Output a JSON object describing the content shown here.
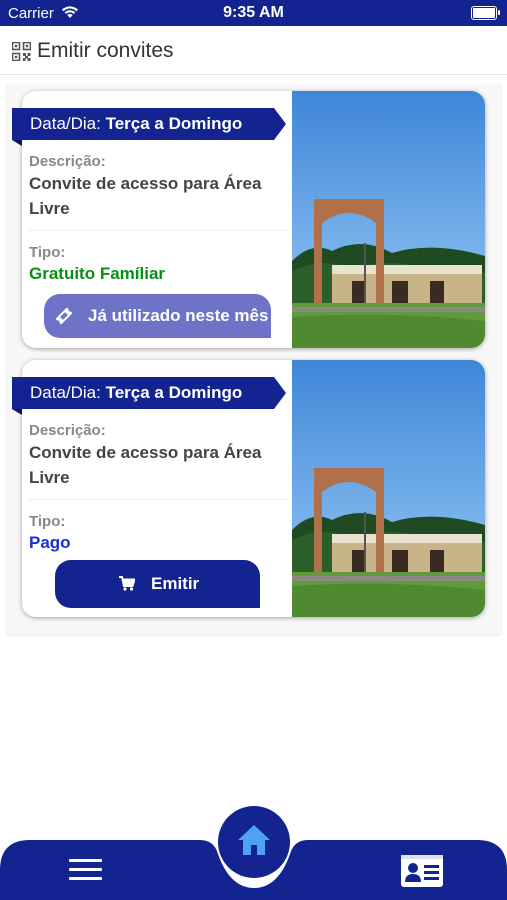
{
  "status_bar": {
    "carrier": "Carrier",
    "time": "9:35 AM"
  },
  "header": {
    "title": "Emitir convites",
    "icon": "qr-code-icon"
  },
  "cards": [
    {
      "ribbon_prefix": "Data/Dia: ",
      "ribbon_value": "Terça a Domingo",
      "descricao_label": "Descrição:",
      "descricao_value": "Convite de acesso para Área Livre",
      "tipo_label": "Tipo:",
      "tipo_value": "Gratuito Famíliar",
      "tipo_color": "#0a8f16",
      "button_label": "Já utilizado neste mês",
      "button_icon": "ticket-icon",
      "button_color": "#6e73c8"
    },
    {
      "ribbon_prefix": "Data/Dia: ",
      "ribbon_value": "Terça a Domingo",
      "descricao_label": "Descrição:",
      "descricao_value": "Convite de acesso para Área Livre",
      "tipo_label": "Tipo:",
      "tipo_value": "Pago",
      "tipo_color": "#1a2fd6",
      "button_label": "Emitir",
      "button_icon": "cart-icon",
      "button_color": "#13238f"
    }
  ],
  "bottom_nav": {
    "items": [
      "menu-icon",
      "home-icon",
      "id-card-icon"
    ],
    "accent": "#13238f"
  }
}
